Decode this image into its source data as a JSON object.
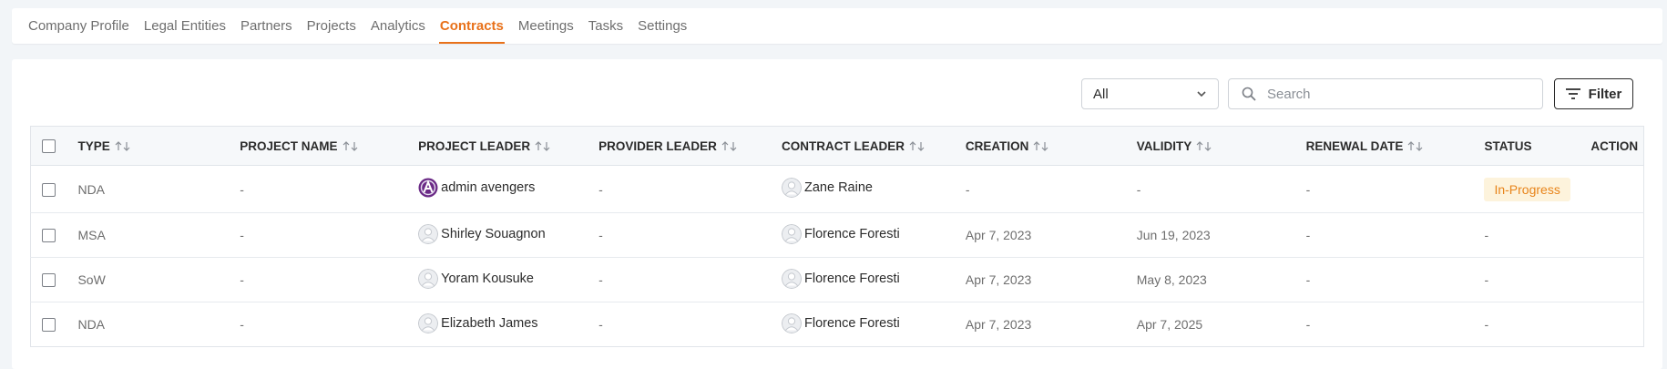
{
  "nav": {
    "tabs": [
      {
        "label": "Company Profile"
      },
      {
        "label": "Legal Entities"
      },
      {
        "label": "Partners"
      },
      {
        "label": "Projects"
      },
      {
        "label": "Analytics"
      },
      {
        "label": "Contracts",
        "active": true
      },
      {
        "label": "Meetings"
      },
      {
        "label": "Tasks"
      },
      {
        "label": "Settings"
      }
    ]
  },
  "toolbar": {
    "select_value": "All",
    "search_placeholder": "Search",
    "filter_label": "Filter"
  },
  "table": {
    "columns": [
      "TYPE",
      "PROJECT NAME",
      "PROJECT LEADER",
      "PROVIDER LEADER",
      "CONTRACT LEADER",
      "CREATION",
      "VALIDITY",
      "RENEWAL DATE",
      "STATUS",
      "ACTION"
    ],
    "rows": [
      {
        "type": "NDA",
        "project_name": "-",
        "project_leader": "admin avengers",
        "provider_leader": "-",
        "contract_leader": "Zane Raine",
        "creation": "-",
        "validity": "-",
        "renewal_date": "-",
        "status": "In-Progress"
      },
      {
        "type": "MSA",
        "project_name": "-",
        "project_leader": "Shirley Souagnon",
        "provider_leader": "-",
        "contract_leader": "Florence Foresti",
        "creation": "Apr 7, 2023",
        "validity": "Jun 19, 2023",
        "renewal_date": "-",
        "status": "-"
      },
      {
        "type": "SoW",
        "project_name": "-",
        "project_leader": "Yoram Kousuke",
        "provider_leader": "-",
        "contract_leader": "Florence Foresti",
        "creation": "Apr 7, 2023",
        "validity": "May 8, 2023",
        "renewal_date": "-",
        "status": "-"
      },
      {
        "type": "NDA",
        "project_name": "-",
        "project_leader": "Elizabeth James",
        "provider_leader": "-",
        "contract_leader": "Florence Foresti",
        "creation": "Apr 7, 2023",
        "validity": "Apr 7, 2025",
        "renewal_date": "-",
        "status": "-"
      }
    ]
  },
  "colors": {
    "accent": "#e8711a",
    "badge_bg": "#fdf3dc",
    "badge_text": "#e8841a"
  }
}
